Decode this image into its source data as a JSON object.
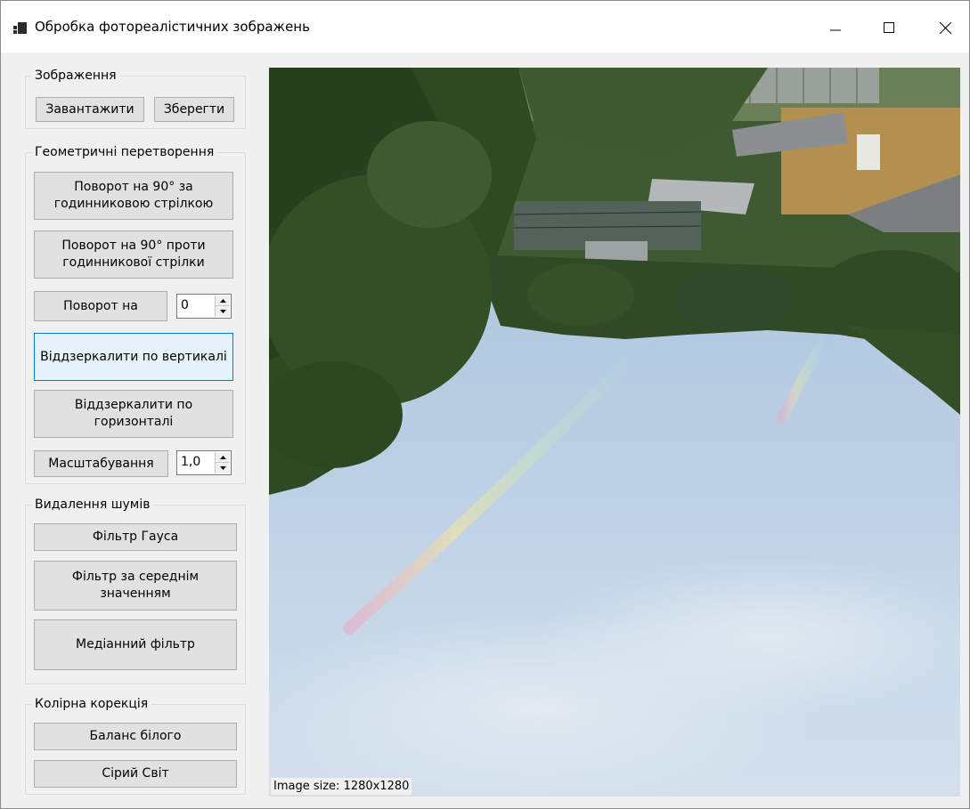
{
  "window": {
    "title": "Обробка фотореалістичних зображень",
    "controls": [
      "minimize-icon",
      "maximize-icon",
      "close-icon"
    ]
  },
  "image_group": {
    "title": "Зображення",
    "load_label": "Завантажити",
    "save_label": "Зберегти"
  },
  "geometry_group": {
    "title": "Геометричні перетворення",
    "rotate_cw_label": "Поворот на 90° за годинниковою стрілкою",
    "rotate_ccw_label": "Поворот на 90° проти годинникової стрілки",
    "rotate_by_label": "Поворот на",
    "rotate_value": "0",
    "mirror_vertical_label": "Віддзеркалити по вертикалі",
    "mirror_horizontal_label": "Віддзеркалити по горизонталі",
    "scale_label": "Масштабування",
    "scale_value": "1,0"
  },
  "noise_group": {
    "title": "Видалення шумів",
    "gauss_label": "Фільтр Гауса",
    "mean_label": "Фільтр за середнім значенням",
    "median_label": "Медіанний фільтр"
  },
  "color_group": {
    "title": "Колірна корекція",
    "white_balance_label": "Баланс білого",
    "gray_world_label": "Сірий Світ"
  },
  "status": {
    "image_size": "Image size: 1280x1280"
  },
  "colors": {
    "window_bg": "#f0f0f0",
    "button_bg": "#e1e1e1",
    "focus_border": "#0078d7",
    "sky": "#b8cee3",
    "foliage": "#2f4a24"
  }
}
